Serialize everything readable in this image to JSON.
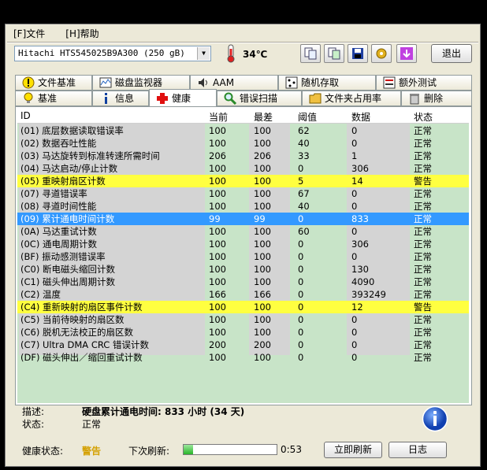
{
  "menu": {
    "file": "[F]文件",
    "help": "[H]帮助"
  },
  "drive": {
    "selected": "Hitachi HTS545025B9A300  (250 gB)"
  },
  "temperature": "34℃",
  "exit_label": "退出",
  "tabs_row1": [
    "文件基准",
    "磁盘监视器",
    "AAM",
    "随机存取",
    "额外测试"
  ],
  "tabs_row2": [
    "基准",
    "信息",
    "健康",
    "错误扫描",
    "文件夹占用率",
    "删除"
  ],
  "table": {
    "headers": [
      "ID",
      "当前",
      "最差",
      "阈值",
      "数据",
      "状态"
    ],
    "rows": [
      {
        "id": "(01) 底层数据读取错误率",
        "cur": "100",
        "worst": "100",
        "thr": "62",
        "data": "0",
        "status": "正常",
        "hl": ""
      },
      {
        "id": "(02) 数据吞吐性能",
        "cur": "100",
        "worst": "100",
        "thr": "40",
        "data": "0",
        "status": "正常",
        "hl": ""
      },
      {
        "id": "(03) 马达旋转到标准转速所需时间",
        "cur": "206",
        "worst": "206",
        "thr": "33",
        "data": "1",
        "status": "正常",
        "hl": ""
      },
      {
        "id": "(04) 马达启动/停止计数",
        "cur": "100",
        "worst": "100",
        "thr": "0",
        "data": "306",
        "status": "正常",
        "hl": ""
      },
      {
        "id": "(05) 重映射扇区计数",
        "cur": "100",
        "worst": "100",
        "thr": "5",
        "data": "14",
        "status": "警告",
        "hl": "warn"
      },
      {
        "id": "(07) 寻道错误率",
        "cur": "100",
        "worst": "100",
        "thr": "67",
        "data": "0",
        "status": "正常",
        "hl": ""
      },
      {
        "id": "(08) 寻道时间性能",
        "cur": "100",
        "worst": "100",
        "thr": "40",
        "data": "0",
        "status": "正常",
        "hl": ""
      },
      {
        "id": "(09) 累计通电时间计数",
        "cur": "99",
        "worst": "99",
        "thr": "0",
        "data": "833",
        "status": "正常",
        "hl": "sel"
      },
      {
        "id": "(0A) 马达重试计数",
        "cur": "100",
        "worst": "100",
        "thr": "60",
        "data": "0",
        "status": "正常",
        "hl": ""
      },
      {
        "id": "(0C) 通电周期计数",
        "cur": "100",
        "worst": "100",
        "thr": "0",
        "data": "306",
        "status": "正常",
        "hl": ""
      },
      {
        "id": "(BF) 振动感测错误率",
        "cur": "100",
        "worst": "100",
        "thr": "0",
        "data": "0",
        "status": "正常",
        "hl": ""
      },
      {
        "id": "(C0) 断电磁头缩回计数",
        "cur": "100",
        "worst": "100",
        "thr": "0",
        "data": "130",
        "status": "正常",
        "hl": ""
      },
      {
        "id": "(C1) 磁头伸出周期计数",
        "cur": "100",
        "worst": "100",
        "thr": "0",
        "data": "4090",
        "status": "正常",
        "hl": ""
      },
      {
        "id": "(C2) 温度",
        "cur": "166",
        "worst": "166",
        "thr": "0",
        "data": "393249",
        "status": "正常",
        "hl": ""
      },
      {
        "id": "(C4) 重新映射的扇区事件计数",
        "cur": "100",
        "worst": "100",
        "thr": "0",
        "data": "12",
        "status": "警告",
        "hl": "warn"
      },
      {
        "id": "(C5) 当前待映射的扇区数",
        "cur": "100",
        "worst": "100",
        "thr": "0",
        "data": "0",
        "status": "正常",
        "hl": ""
      },
      {
        "id": "(C6) 脱机无法校正的扇区数",
        "cur": "100",
        "worst": "100",
        "thr": "0",
        "data": "0",
        "status": "正常",
        "hl": ""
      },
      {
        "id": "(C7) Ultra DMA CRC 错误计数",
        "cur": "200",
        "worst": "200",
        "thr": "0",
        "data": "0",
        "status": "正常",
        "hl": ""
      },
      {
        "id": "(DF) 磁头伸出／缩回重试计数",
        "cur": "100",
        "worst": "100",
        "thr": "0",
        "data": "0",
        "status": "正常",
        "hl": ""
      }
    ]
  },
  "description": {
    "label": "描述:",
    "text": "硬盘累计通电时间: 833 小时 (34 天)",
    "status_label": "状态:",
    "status_text": "正常"
  },
  "footer": {
    "health_label": "健康状态:",
    "health_value": "警告",
    "next_refresh_label": "下次刷新:",
    "progress_fraction": 0.1,
    "time": "0:53",
    "refresh_button": "立即刷新",
    "log_button": "日志"
  }
}
